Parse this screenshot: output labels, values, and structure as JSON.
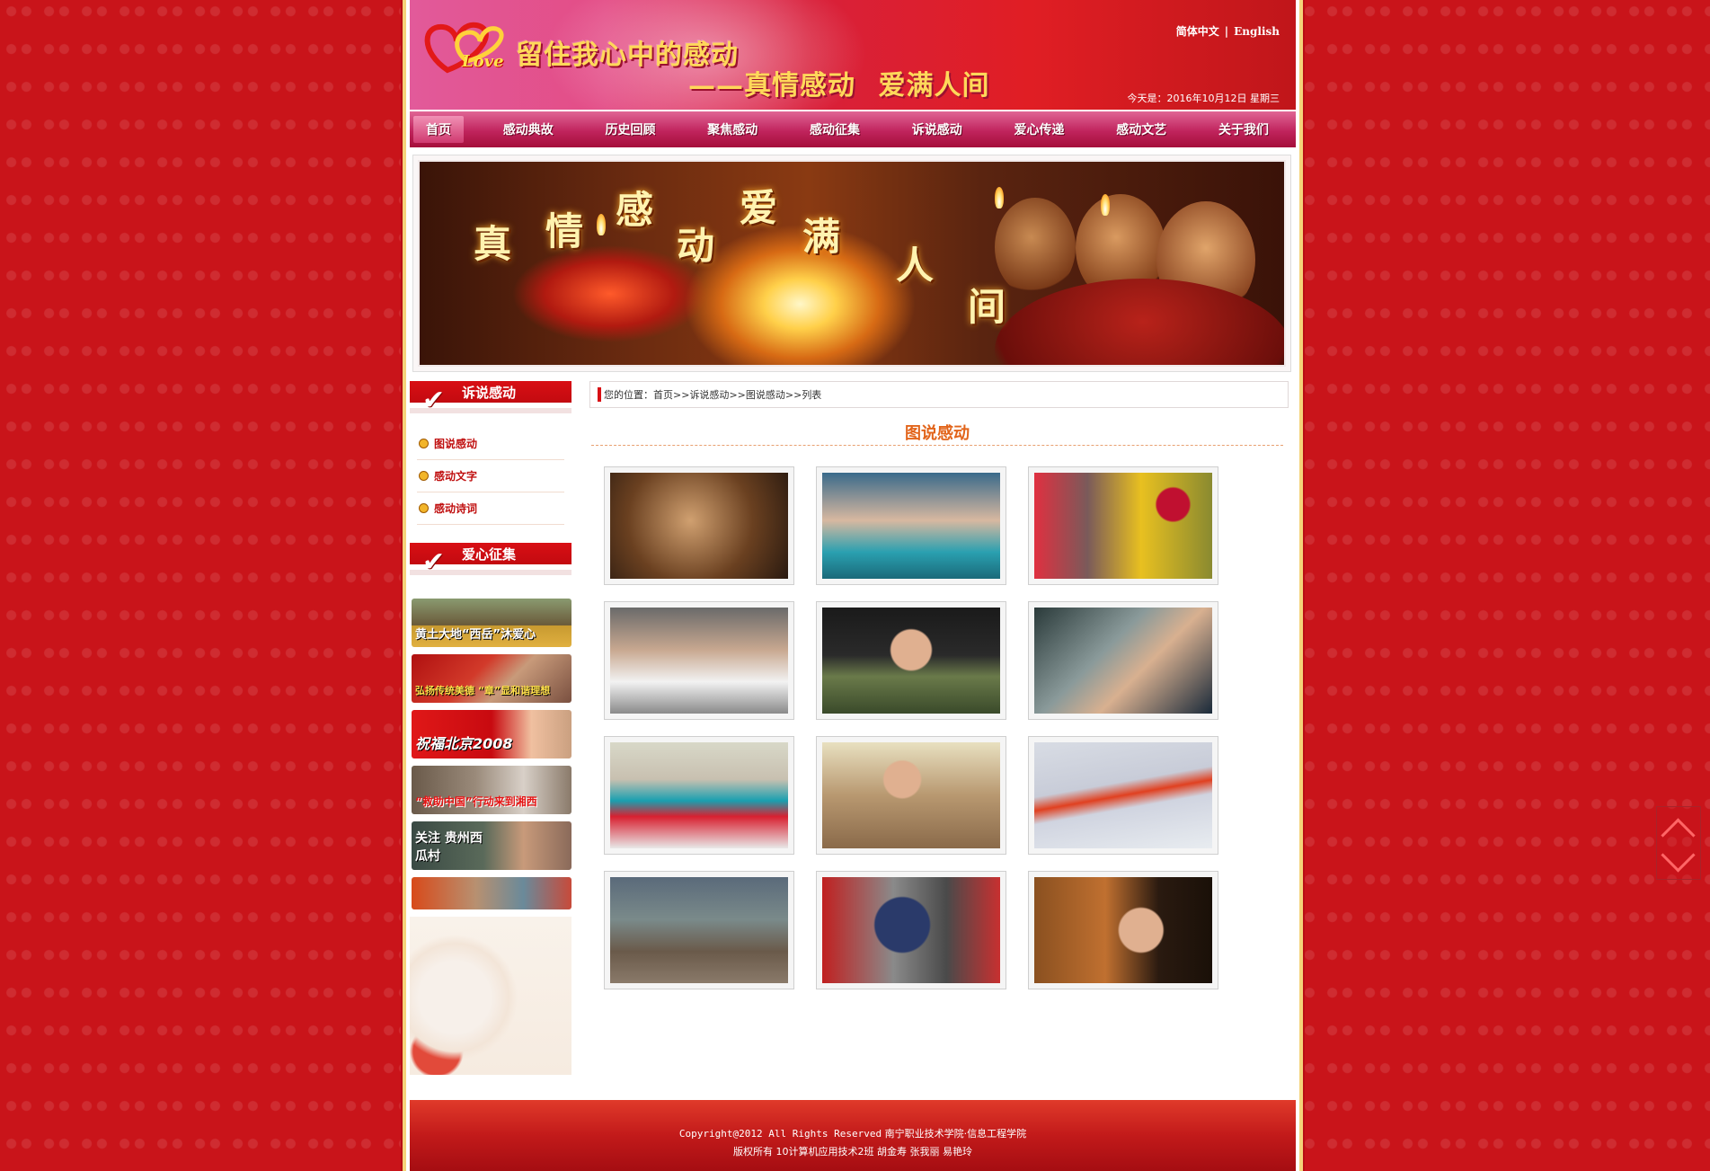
{
  "header": {
    "logo_word": "Love",
    "slogan_line1": "留住我心中的感动",
    "slogan_line2": "——真情感动 爱满人间",
    "lang_cn": "简体中文",
    "lang_sep": "|",
    "lang_en": "English",
    "date": "今天是：2016年10月12日 星期三"
  },
  "nav": {
    "items": [
      "首页",
      "感动典故",
      "历史回顾",
      "聚焦感动",
      "感动征集",
      "诉说感动",
      "爱心传递",
      "感动文艺",
      "关于我们"
    ]
  },
  "banner": {
    "chars": [
      "真",
      "情",
      "感",
      "动",
      "爱",
      "满",
      "人",
      "间"
    ]
  },
  "sidebar": {
    "section1_title": "诉说感动",
    "links": [
      "图说感动",
      "感动文字",
      "感动诗词"
    ],
    "section2_title": "爱心征集",
    "promos": [
      "黄土大地“西岳”沐爱心",
      "弘扬传统美德 “章”显和谐理想",
      "祝福北京2008",
      "“救助中国”行动来到湘西",
      "关注 贵州西瓜村",
      ""
    ]
  },
  "breadcrumb": {
    "prefix": "您的位置：",
    "home": "首页",
    "sep1": ">>",
    "level1": "诉说感动",
    "sep2": ">>",
    "level2": "图说感动",
    "sep3": ">>",
    "level3": "列表"
  },
  "main": {
    "title": "图说感动"
  },
  "footer": {
    "line1_copy": "Copyright@2012 All Rights Reserved",
    "line1_org": "南宁职业技术学院·信息工程学院",
    "line2": "版权所有 10计算机应用技术2班 胡金寿 张我丽 易艳玲"
  },
  "colors": {
    "brand_red": "#d80f14",
    "accent_orange": "#e2641a",
    "page_bg": "#c9141a"
  }
}
